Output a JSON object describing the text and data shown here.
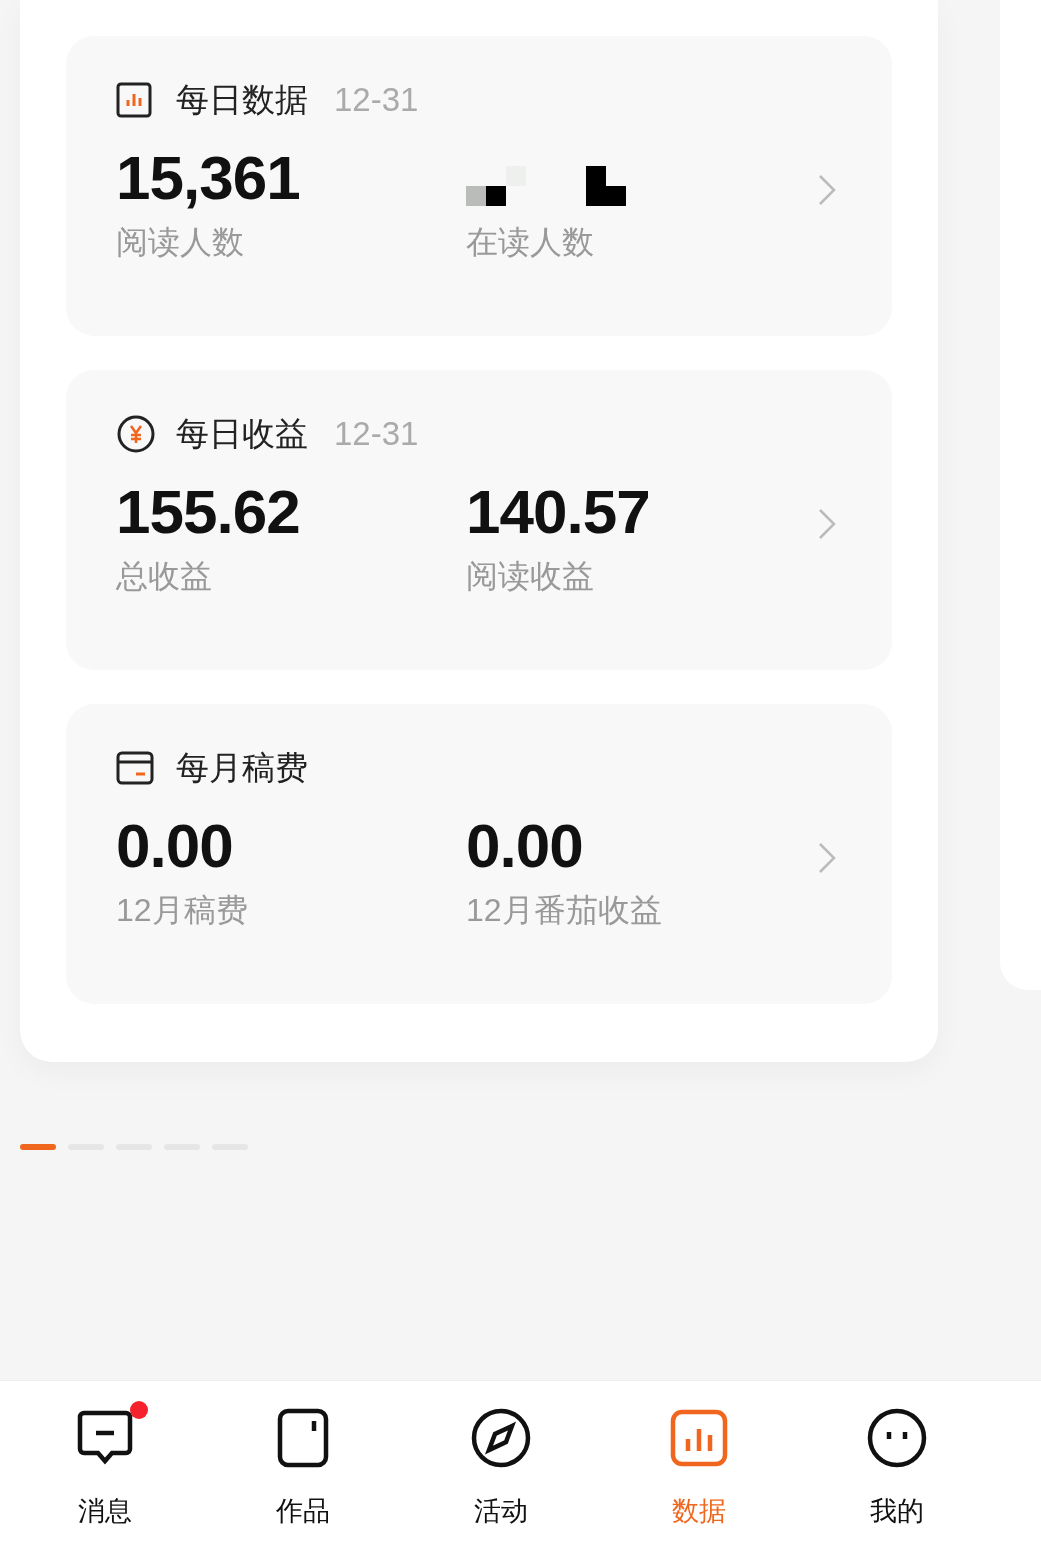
{
  "cards": [
    {
      "kind": "chart",
      "title": "每日数据",
      "date": "12-31",
      "metrics": [
        {
          "kind": "value",
          "value": "15,361",
          "label": "阅读人数"
        },
        {
          "kind": "redacted",
          "label": "在读人数"
        }
      ]
    },
    {
      "kind": "yen",
      "title": "每日收益",
      "date": "12-31",
      "metrics": [
        {
          "kind": "value",
          "value": "155.62",
          "label": "总收益"
        },
        {
          "kind": "value",
          "value": "140.57",
          "label": "阅读收益"
        }
      ]
    },
    {
      "kind": "wallet",
      "title": "每月稿费",
      "metrics": [
        {
          "kind": "value",
          "value": "0.00",
          "label": "12月稿费"
        },
        {
          "kind": "value",
          "value": "0.00",
          "label": "12月番茄收益"
        }
      ]
    }
  ],
  "page_dots": [
    {
      "selected": true
    },
    {
      "selected": false
    },
    {
      "selected": false
    },
    {
      "selected": false
    },
    {
      "selected": false
    }
  ],
  "nav": [
    {
      "kind": "message",
      "label": "消息",
      "selected": false,
      "badge": true
    },
    {
      "kind": "works",
      "label": "作品",
      "selected": false,
      "badge": false
    },
    {
      "kind": "compass",
      "label": "活动",
      "selected": false,
      "badge": false
    },
    {
      "kind": "chart",
      "label": "数据",
      "selected": true,
      "badge": false
    },
    {
      "kind": "face",
      "label": "我的",
      "selected": false,
      "badge": false
    }
  ]
}
